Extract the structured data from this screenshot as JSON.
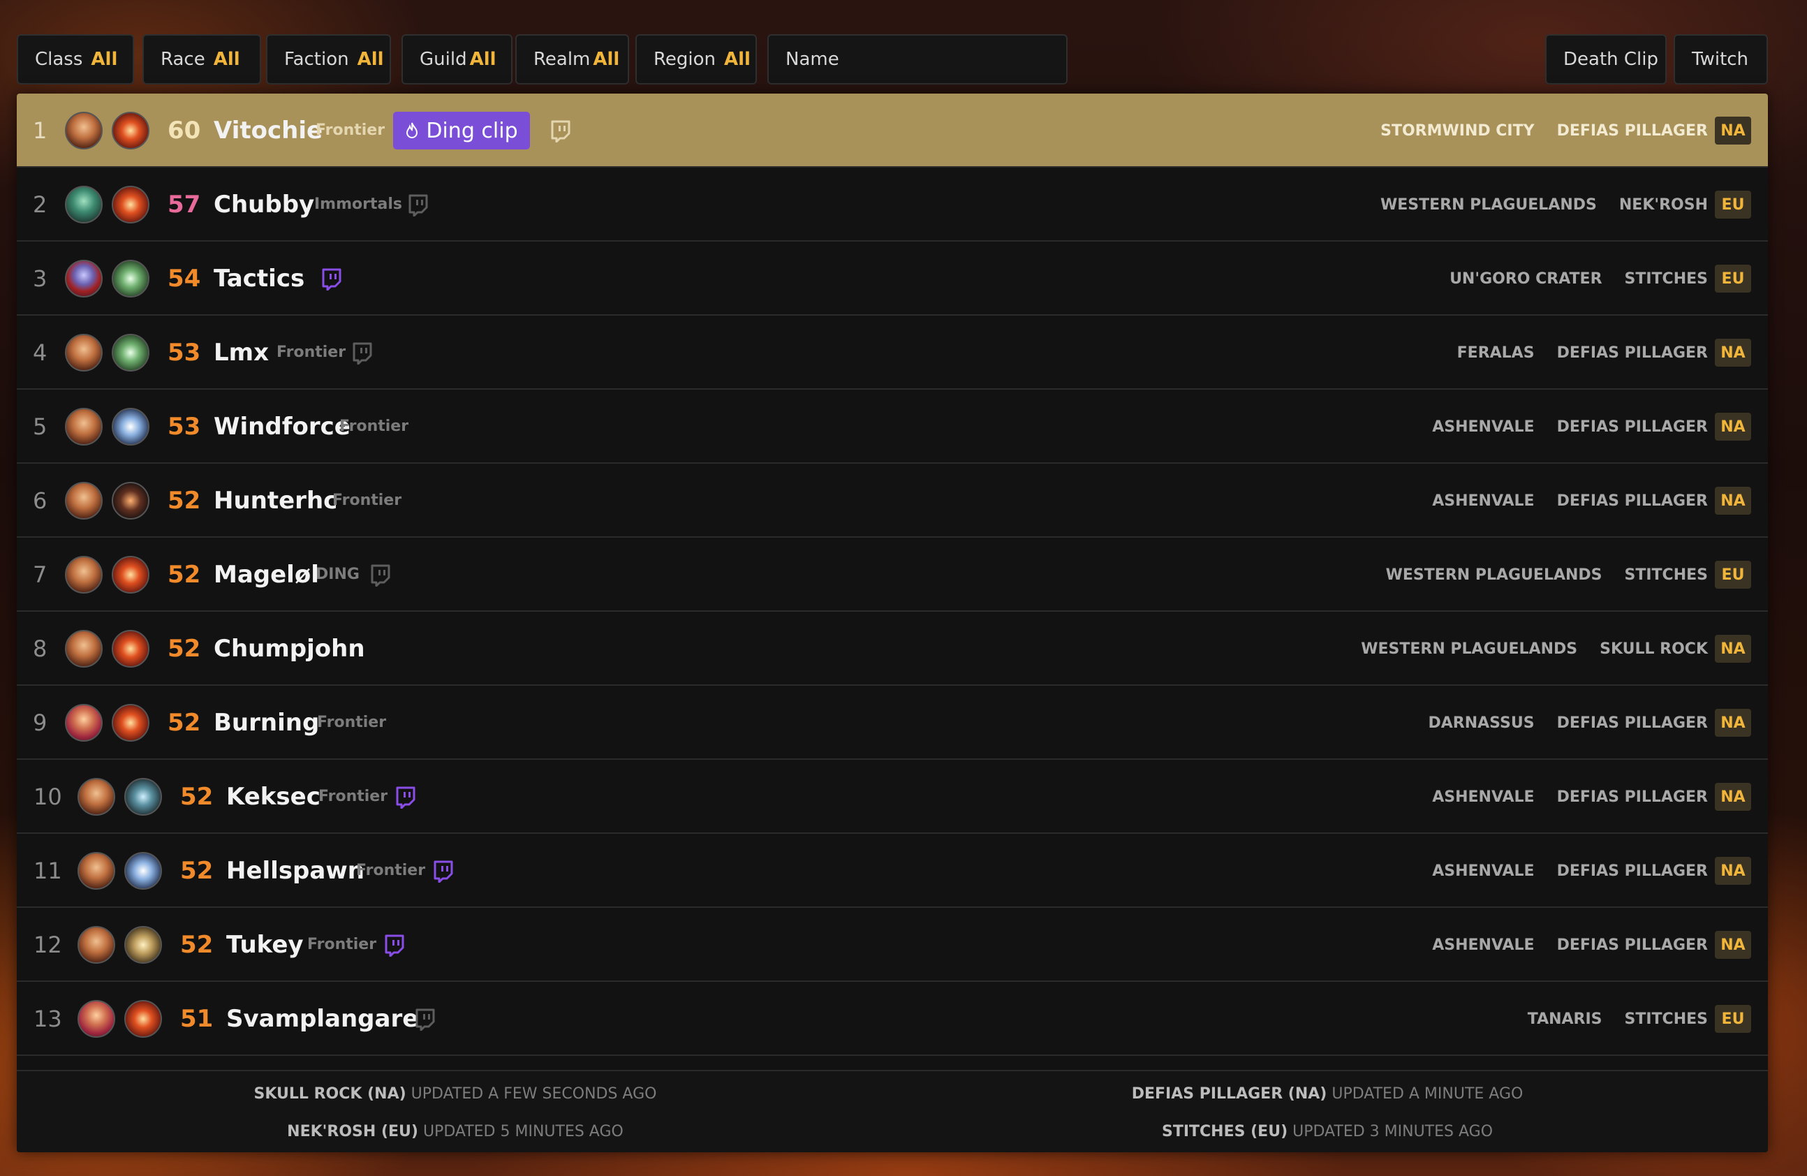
{
  "filters": {
    "class": {
      "label": "Class",
      "value": "All"
    },
    "race": {
      "label": "Race",
      "value": "All"
    },
    "faction": {
      "label": "Faction",
      "value": "All"
    },
    "guild": {
      "label": "Guild",
      "value": "All"
    },
    "realm": {
      "label": "Realm",
      "value": "All"
    },
    "region": {
      "label": "Region",
      "value": "All"
    },
    "name_placeholder": "Name",
    "death_clip": "Death Clip",
    "twitch": "Twitch"
  },
  "ding_clip_label": "Ding clip",
  "rows": [
    {
      "rank": "1",
      "level": "60",
      "name": "Vitochie",
      "guild": "Frontier",
      "zone": "STORMWIND CITY",
      "realm": "DEFIAS PILLAGER",
      "region": "NA",
      "twitch": "gray",
      "ding": true
    },
    {
      "rank": "2",
      "level": "57",
      "name": "Chubby",
      "guild": "Immortals",
      "zone": "WESTERN PLAGUELANDS",
      "realm": "NEK'ROSH",
      "region": "EU",
      "twitch": "gray",
      "level_color": "#e86a9a"
    },
    {
      "rank": "3",
      "level": "54",
      "name": "Tactics",
      "guild": "",
      "zone": "UN'GORO CRATER",
      "realm": "STITCHES",
      "region": "EU",
      "twitch": "purple"
    },
    {
      "rank": "4",
      "level": "53",
      "name": "Lmx",
      "guild": "Frontier",
      "zone": "FERALAS",
      "realm": "DEFIAS PILLAGER",
      "region": "NA",
      "twitch": "gray"
    },
    {
      "rank": "5",
      "level": "53",
      "name": "Windforce",
      "guild": "Frontier",
      "zone": "ASHENVALE",
      "realm": "DEFIAS PILLAGER",
      "region": "NA",
      "twitch": "none"
    },
    {
      "rank": "6",
      "level": "52",
      "name": "Hunterhc",
      "guild": "Frontier",
      "zone": "ASHENVALE",
      "realm": "DEFIAS PILLAGER",
      "region": "NA",
      "twitch": "none"
    },
    {
      "rank": "7",
      "level": "52",
      "name": "Mageløl",
      "guild": "DING",
      "zone": "WESTERN PLAGUELANDS",
      "realm": "STITCHES",
      "region": "EU",
      "twitch": "gray"
    },
    {
      "rank": "8",
      "level": "52",
      "name": "Chumpjohn",
      "guild": "",
      "zone": "WESTERN PLAGUELANDS",
      "realm": "SKULL ROCK",
      "region": "NA",
      "twitch": "none"
    },
    {
      "rank": "9",
      "level": "52",
      "name": "Burning",
      "guild": "Frontier",
      "zone": "DARNASSUS",
      "realm": "DEFIAS PILLAGER",
      "region": "NA",
      "twitch": "none"
    },
    {
      "rank": "10",
      "level": "52",
      "name": "Keksec",
      "guild": "Frontier",
      "zone": "ASHENVALE",
      "realm": "DEFIAS PILLAGER",
      "region": "NA",
      "twitch": "purple"
    },
    {
      "rank": "11",
      "level": "52",
      "name": "Hellspawn",
      "guild": "Frontier",
      "zone": "ASHENVALE",
      "realm": "DEFIAS PILLAGER",
      "region": "NA",
      "twitch": "purple"
    },
    {
      "rank": "12",
      "level": "52",
      "name": "Tukey",
      "guild": "Frontier",
      "zone": "ASHENVALE",
      "realm": "DEFIAS PILLAGER",
      "region": "NA",
      "twitch": "purple"
    },
    {
      "rank": "13",
      "level": "51",
      "name": "Svamplangare",
      "guild": "",
      "zone": "TANARIS",
      "realm": "STITCHES",
      "region": "EU",
      "twitch": "gray"
    }
  ],
  "footer": [
    {
      "realm": "SKULL ROCK (NA)",
      "status": "UPDATED A FEW SECONDS AGO"
    },
    {
      "realm": "DEFIAS PILLAGER (NA)",
      "status": "UPDATED A MINUTE AGO"
    },
    {
      "realm": "NEK'ROSH (EU)",
      "status": "UPDATED 5 MINUTES AGO"
    },
    {
      "realm": "STITCHES (EU)",
      "status": "UPDATED 3 MINUTES AGO"
    }
  ],
  "colors": {
    "accent": "#f0b53a",
    "level": "#f08a2a",
    "twitch_purple": "#8a4ee8",
    "twitch_gray": "#5e5e5e",
    "ding_button": "#7b4ed8",
    "highlight_row": "#a8925a"
  }
}
